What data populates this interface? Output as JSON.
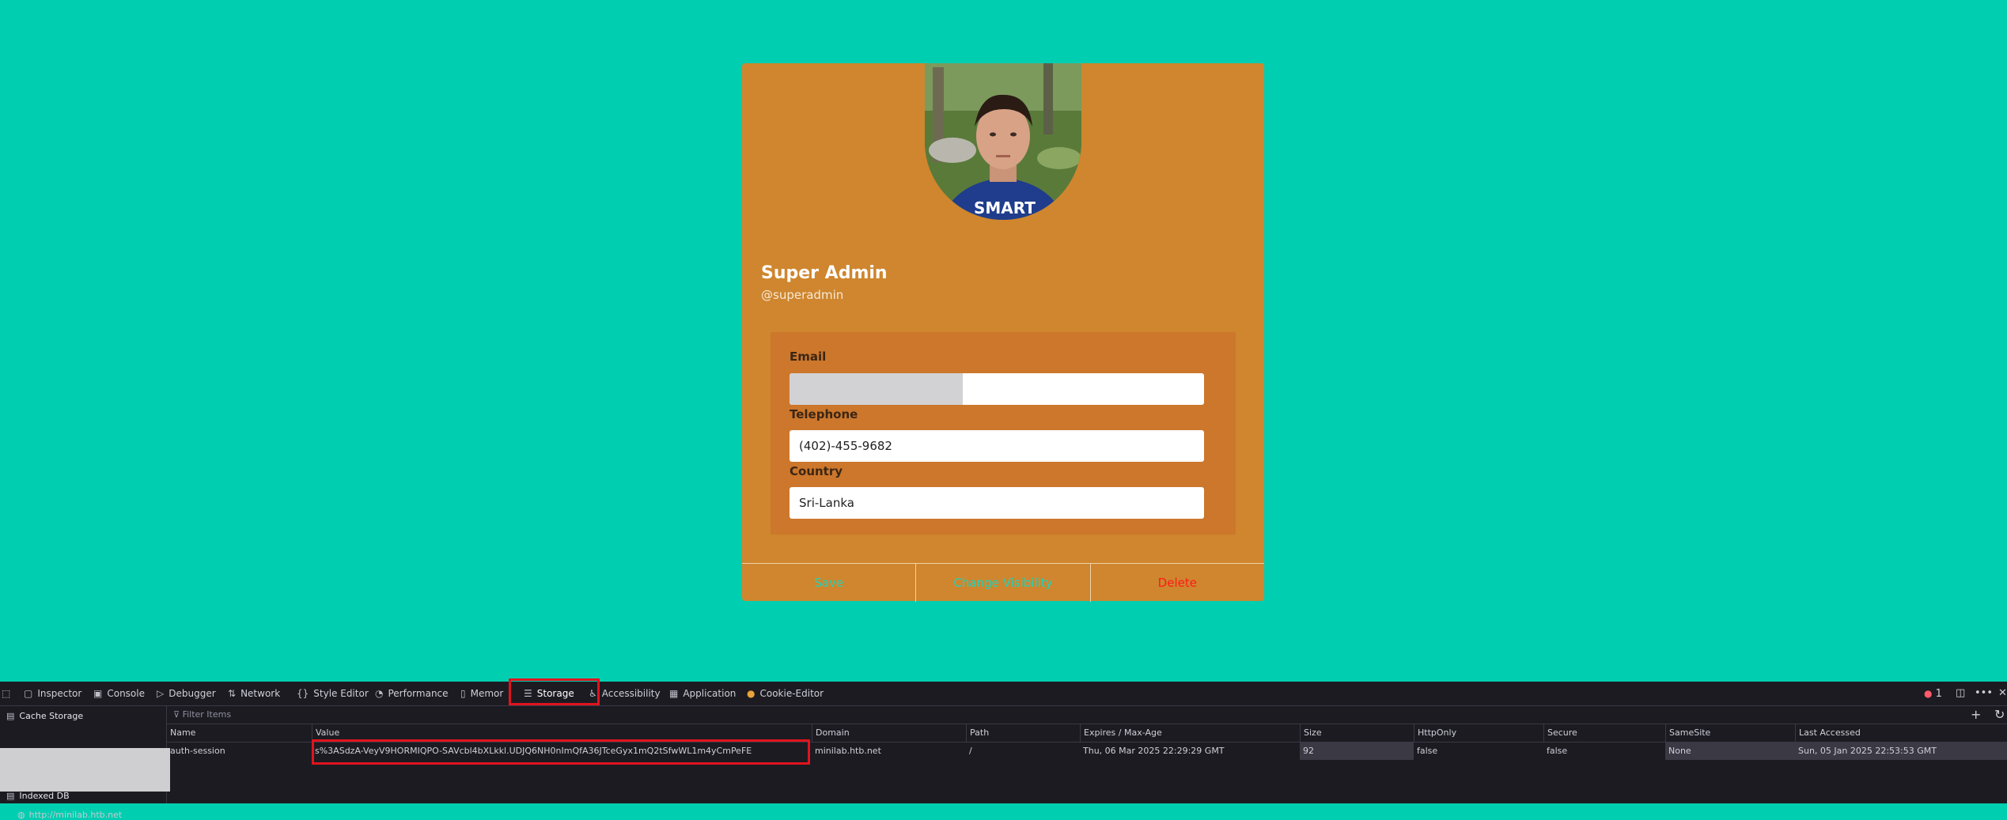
{
  "profile": {
    "name": "Super Admin",
    "username": "@superadmin",
    "fields": {
      "email_label": "Email",
      "email_value": "",
      "telephone_label": "Telephone",
      "telephone_value": "(402)-455-9682",
      "country_label": "Country",
      "country_value": "Sri-Lanka"
    },
    "actions": {
      "save": "Save",
      "change_visibility": "Change Visibility",
      "delete": "Delete"
    }
  },
  "colors": {
    "page_background": "#00ceb0",
    "card_background": "#cf862e",
    "fields_background": "#cc772c",
    "action_accent": "#1fd3bd",
    "danger": "#ff1a1a",
    "highlight_box": "#e0141e",
    "devtools_background": "#1c1b22"
  },
  "devtools": {
    "tabs": [
      {
        "label": "Inspector",
        "icon": "inspector-icon"
      },
      {
        "label": "Console",
        "icon": "console-icon"
      },
      {
        "label": "Debugger",
        "icon": "debugger-icon"
      },
      {
        "label": "Network",
        "icon": "network-icon"
      },
      {
        "label": "Style Editor",
        "icon": "style-editor-icon"
      },
      {
        "label": "Performance",
        "icon": "performance-icon"
      },
      {
        "label": "Memor",
        "icon": "memory-icon"
      },
      {
        "label": "Storage",
        "icon": "storage-icon"
      },
      {
        "label": "Accessibility",
        "icon": "accessibility-icon"
      },
      {
        "label": "Application",
        "icon": "application-icon"
      },
      {
        "label": "Cookie-Editor",
        "icon": "cookie-icon"
      }
    ],
    "active_tab": "Storage",
    "error_count": "1",
    "sidebar": {
      "items": [
        "Cache Storage",
        "Indexed DB"
      ],
      "sub_items": [
        "http://minilab.htb.net"
      ]
    },
    "filter_placeholder": "Filter Items",
    "columns": [
      "Name",
      "Value",
      "Domain",
      "Path",
      "Expires / Max-Age",
      "Size",
      "HttpOnly",
      "Secure",
      "SameSite",
      "Last Accessed"
    ],
    "rows": [
      {
        "name": "auth-session",
        "value": "s%3ASdzA-VeyV9HORMIQPO-SAVcbl4bXLkkl.UDJQ6NH0nImQfA36JTceGyx1mQ2tSfwWL1m4yCmPeFE",
        "domain": "minilab.htb.net",
        "path": "/",
        "expires": "Thu, 06 Mar 2025 22:29:29 GMT",
        "size": "92",
        "httponly": "false",
        "secure": "false",
        "samesite": "None",
        "last_accessed": "Sun, 05 Jan 2025 22:53:53 GMT"
      }
    ]
  }
}
